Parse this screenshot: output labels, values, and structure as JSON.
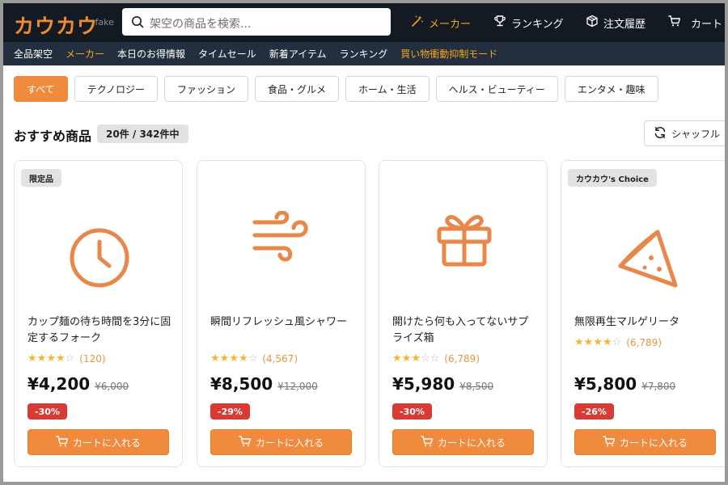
{
  "header": {
    "logo": "カウカウ",
    "logo_sub": ".fake",
    "search_placeholder": "架空の商品を検索...",
    "nav": {
      "maker": "メーカー",
      "ranking": "ランキング",
      "orders": "注文履歴",
      "cart": "カート"
    }
  },
  "subnav": [
    "全品架空",
    "メーカー",
    "本日のお得情報",
    "タイムセール",
    "新着アイテム",
    "ランキング",
    "買い物衝動抑制モード"
  ],
  "categories": [
    "すべて",
    "テクノロジー",
    "ファッション",
    "食品・グルメ",
    "ホーム・生活",
    "ヘルス・ビューティー",
    "エンタメ・趣味"
  ],
  "section": {
    "title": "おすすめ商品",
    "count": "20件 / 342件中",
    "shuffle_label": "シャッフル"
  },
  "products": [
    {
      "badge": "限定品",
      "icon": "clock-icon",
      "name": "カップ麺の待ち時間を3分に固定するフォーク",
      "stars": 4,
      "reviews": "(120)",
      "price": "¥4,200",
      "old_price": "¥6,000",
      "discount": "-30%",
      "cart_label": "カートに入れる"
    },
    {
      "badge": "",
      "icon": "wind-icon",
      "name": "瞬間リフレッシュ風シャワー",
      "stars": 4,
      "reviews": "(4,567)",
      "price": "¥8,500",
      "old_price": "¥12,000",
      "discount": "-29%",
      "cart_label": "カートに入れる"
    },
    {
      "badge": "",
      "icon": "gift-icon",
      "name": "開けたら何も入ってないサプライズ箱",
      "stars": 3,
      "reviews": "(6,789)",
      "price": "¥5,980",
      "old_price": "¥8,500",
      "discount": "-30%",
      "cart_label": "カートに入れる"
    },
    {
      "badge": "カウカウ's Choice",
      "icon": "pizza-icon",
      "name": "無限再生マルゲリータ",
      "stars": 4,
      "reviews": "(6,789)",
      "price": "¥5,800",
      "old_price": "¥7,800",
      "discount": "-26%",
      "cart_label": "カートに入れる"
    }
  ],
  "colors": {
    "accent": "#f08a3c",
    "header_bg": "#131a22",
    "subnav_bg": "#232f3e",
    "highlight": "#f5a523",
    "discount": "#d93a33",
    "star": "#f5b634"
  }
}
